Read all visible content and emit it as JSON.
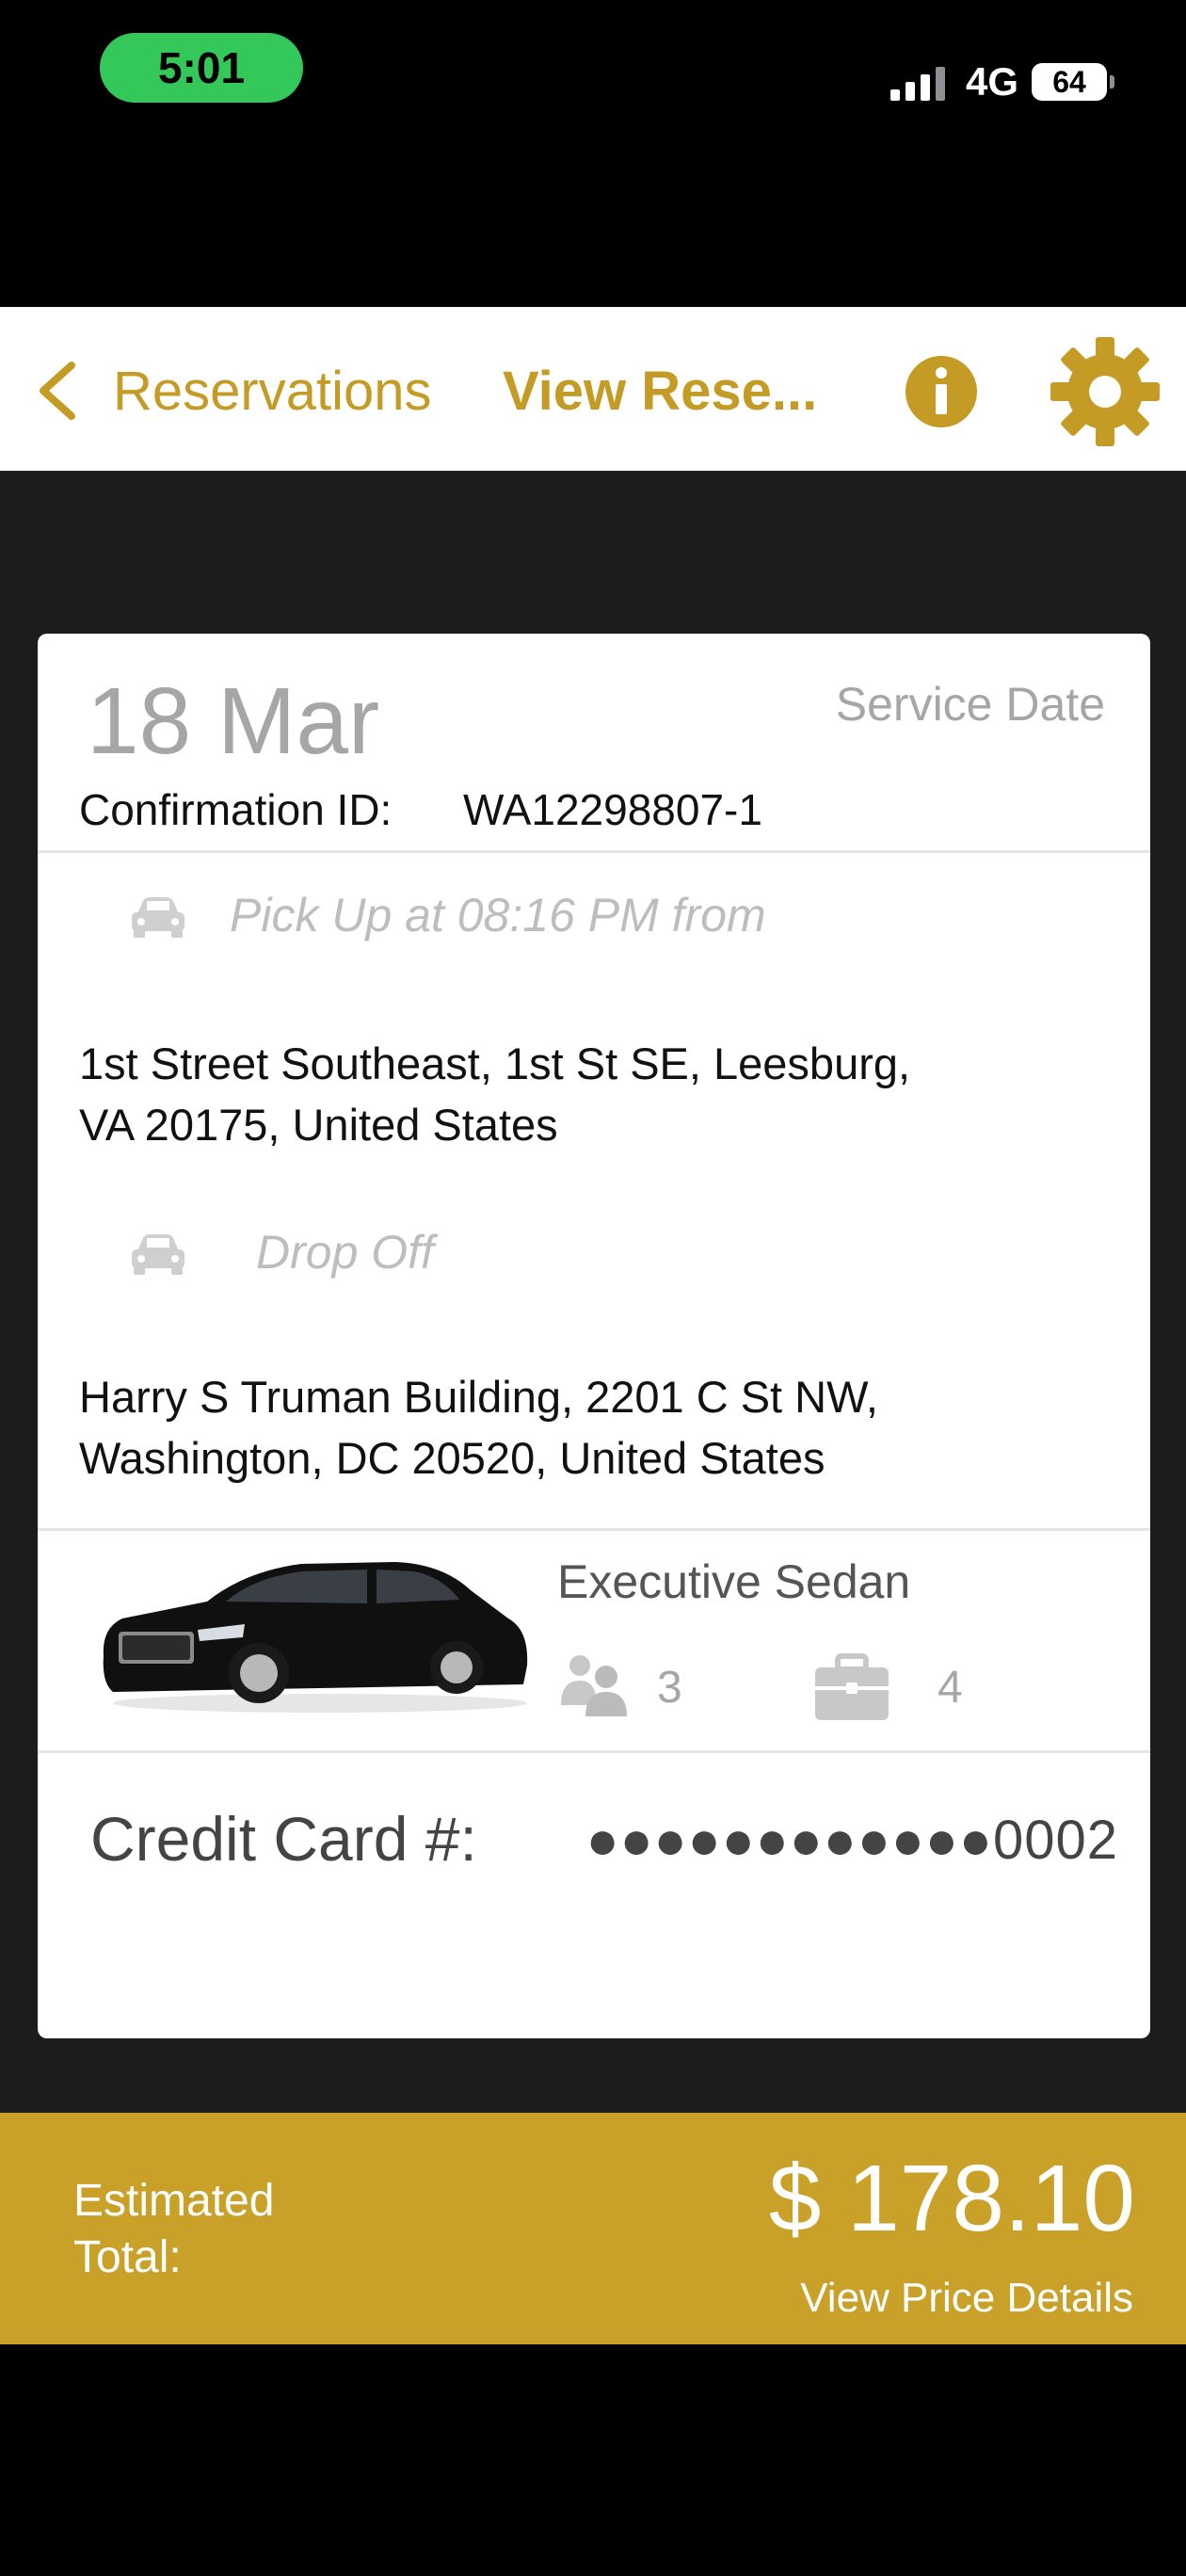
{
  "status_bar": {
    "time": "5:01",
    "network": "4G",
    "battery": "64"
  },
  "nav": {
    "back_label": "Reservations",
    "title": "View Rese...",
    "accent_color": "#c49b24",
    "icons": [
      "chevron-left-icon",
      "info-icon",
      "gear-icon"
    ]
  },
  "reservation": {
    "date": "18 Mar",
    "service_date_label": "Service Date",
    "confirmation_label": "Confirmation ID:",
    "confirmation_id": "WA12298807-1",
    "pickup_label": "Pick Up at 08:16 PM from",
    "pickup_address_line1": "1st Street Southeast, 1st St SE, Leesburg,",
    "pickup_address_line2": "VA 20175, United States",
    "dropoff_label": "Drop Off",
    "dropoff_address_line1": "Harry S Truman Building, 2201 C St NW,",
    "dropoff_address_line2": "Washington, DC 20520, United States",
    "vehicle_type": "Executive Sedan",
    "passengers": "3",
    "luggage": "4",
    "credit_card_label": "Credit Card #:",
    "credit_card_value": "●●●●●●●●●●●●0002"
  },
  "footer": {
    "estimated_label": "Estimated Total:",
    "total": "$ 178.10",
    "price_details_link": "View Price Details",
    "background_color": "#c9a028"
  }
}
